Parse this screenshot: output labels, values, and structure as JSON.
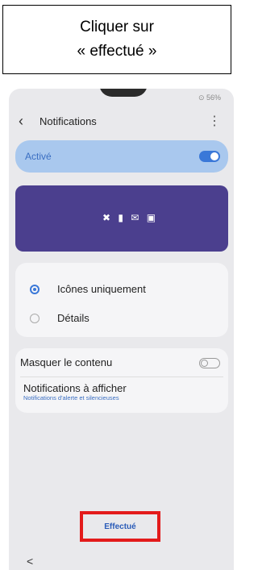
{
  "instruction": {
    "line1": "Cliquer sur",
    "line2": "« effectué »"
  },
  "statusbar": {
    "text": "⊙ 56%"
  },
  "appbar": {
    "back_icon": "‹",
    "title": "Notifications",
    "more_icon": "⋮"
  },
  "active": {
    "label": "Activé",
    "enabled": true,
    "accent": "#3a78d8"
  },
  "preview": {
    "icons": "✖ ▮ ✉ ▣"
  },
  "style_options": [
    {
      "label": "Icônes uniquement",
      "selected": true
    },
    {
      "label": "Détails",
      "selected": false
    }
  ],
  "mask": {
    "label": "Masquer le contenu",
    "enabled": false
  },
  "notifications_to_show": {
    "label": "Notifications à afficher",
    "sub": "Notifications d'alerte et silencieuses"
  },
  "done_button": {
    "label": "Effectué",
    "highlight_color": "#e31b1b"
  },
  "nav": {
    "back_icon": "<"
  }
}
